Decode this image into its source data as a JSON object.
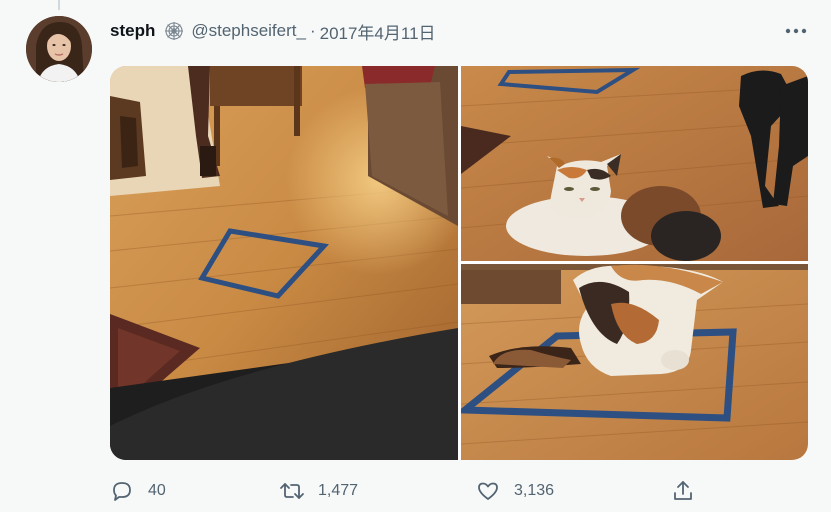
{
  "tweet": {
    "author_name": "steph",
    "handle": "@stephseifert_",
    "separator": "·",
    "date": "2017年4月11日",
    "badge_icon": "spiderweb-icon",
    "more_icon": "more-icon"
  },
  "media": {
    "images": [
      {
        "icon": "photo-taped-square-floor"
      },
      {
        "icon": "photo-cat-near-square"
      },
      {
        "icon": "photo-cat-sitting-in-square"
      }
    ]
  },
  "actions": {
    "reply_count": "40",
    "retweet_count": "1,477",
    "like_count": "3,136"
  },
  "colors": {
    "background": "#f7f9f9",
    "text": "#0f1419",
    "secondary_text": "#536471",
    "tape": "#2d4f82"
  }
}
